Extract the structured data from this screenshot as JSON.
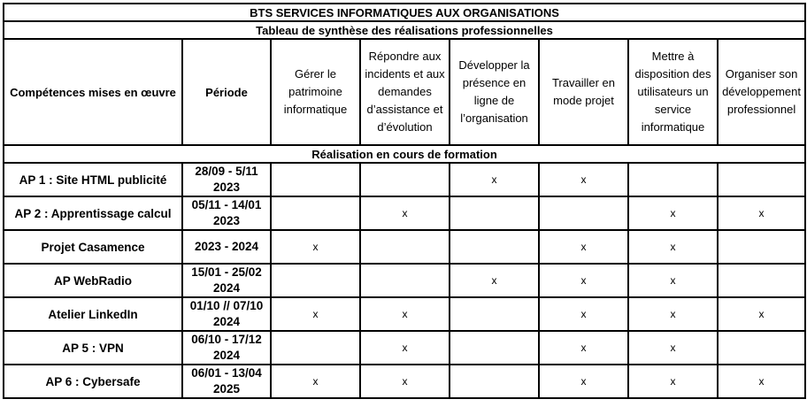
{
  "title": "BTS SERVICES INFORMATIQUES AUX ORGANISATIONS",
  "subtitle": "Tableau de synthèse des réalisations professionnelles",
  "headers": {
    "competences": "Compétences mises en œuvre",
    "periode": "Période",
    "columns": [
      "Gérer le patrimoine informatique",
      "Répondre aux incidents et aux demandes d’assistance et d’évolution",
      "Développer la présence en ligne de l’organisation",
      "Travailler en mode projet",
      "Mettre à disposition des utilisateurs un service informatique",
      "Organiser son développement professionnel"
    ]
  },
  "section_label": "Réalisation en cours de formation",
  "mark_symbol": "x",
  "rows": [
    {
      "name": "AP 1 : Site HTML publicité",
      "period": "28/09 - 5/11 2023",
      "marks": [
        false,
        false,
        true,
        true,
        false,
        false
      ]
    },
    {
      "name": "AP 2 : Apprentissage calcul",
      "period": "05/11 - 14/01 2023",
      "marks": [
        false,
        true,
        false,
        false,
        true,
        true
      ]
    },
    {
      "name": "Projet Casamence",
      "period": "2023 - 2024",
      "marks": [
        true,
        false,
        false,
        true,
        true,
        false
      ]
    },
    {
      "name": "AP WebRadio",
      "period": "15/01 - 25/02 2024",
      "marks": [
        false,
        false,
        true,
        true,
        true,
        false
      ]
    },
    {
      "name": "Atelier LinkedIn",
      "period": "01/10 // 07/10 2024",
      "marks": [
        true,
        true,
        false,
        true,
        true,
        true
      ]
    },
    {
      "name": "AP 5 : VPN",
      "period": "06/10 - 17/12 2024",
      "marks": [
        false,
        true,
        false,
        true,
        true,
        false
      ]
    },
    {
      "name": "AP 6 : Cybersafe",
      "period": "06/01 - 13/04 2025",
      "marks": [
        true,
        true,
        false,
        true,
        true,
        true
      ]
    }
  ]
}
